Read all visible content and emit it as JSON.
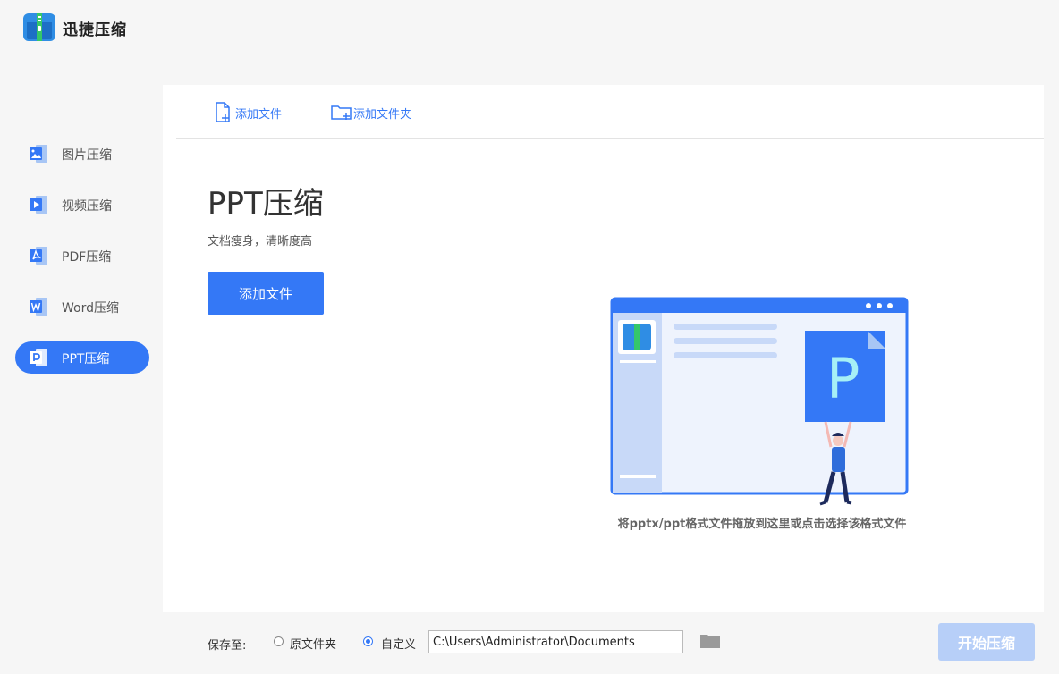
{
  "app": {
    "title": "迅捷压缩",
    "logo_icon": "zip-archive-icon",
    "accent_color": "#3478f6"
  },
  "sidebar": {
    "items": [
      {
        "label": "图片压缩",
        "icon": "image-file-icon",
        "active": false
      },
      {
        "label": "视频压缩",
        "icon": "video-file-icon",
        "active": false
      },
      {
        "label": "PDF压缩",
        "icon": "pdf-file-icon",
        "active": false
      },
      {
        "label": "Word压缩",
        "icon": "word-file-icon",
        "active": false
      },
      {
        "label": "PPT压缩",
        "icon": "ppt-file-icon",
        "active": true
      }
    ]
  },
  "toolbar": {
    "add_file_label": "添加文件",
    "add_folder_label": "添加文件夹"
  },
  "main": {
    "title": "PPT压缩",
    "subtitle": "文档瘦身，清晰度高",
    "add_file_button": "添加文件",
    "drop_hint": "将pptx/ppt格式文件拖放到这里或点击选择该格式文件",
    "illustration_letter": "P"
  },
  "footer": {
    "save_label": "保存至:",
    "option_original": "原文件夹",
    "option_custom": "自定义",
    "selected_option": "自定义",
    "path_value": "C:\\Users\\Administrator\\Documents",
    "start_button": "开始压缩"
  }
}
